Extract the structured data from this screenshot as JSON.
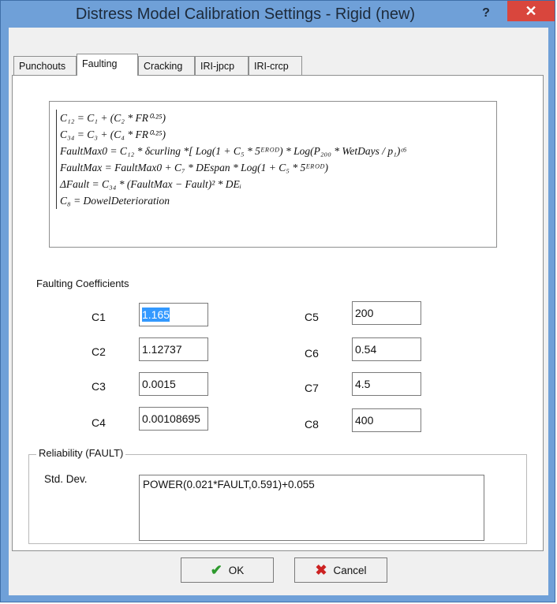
{
  "window": {
    "title": "Distress Model Calibration Settings - Rigid (new)",
    "help_glyph": "?",
    "close_glyph": "✕"
  },
  "tabs": [
    {
      "label": "Punchouts"
    },
    {
      "label": "Faulting"
    },
    {
      "label": "Cracking"
    },
    {
      "label": "IRI-jpcp"
    },
    {
      "label": "IRI-crcp"
    }
  ],
  "active_tab": "Faulting",
  "formula": {
    "lines": [
      "C₁₂ = C₁ + (C₂ * FR⁰·²⁵)",
      "C₃₄ = C₃ + (C₄ * FR⁰·²⁵)",
      "FaultMax0 = C₁₂ * δcurling *[ Log(1 + C₅ * 5ᴱᴿᴼᴰ) * Log(P₂₀₀ * WetDays / p₁)ᶜ⁶",
      "FaultMax = FaultMax0 + C₇ * DEspan * Log(1 + C₅ * 5ᴱᴿᴼᴰ)",
      "ΔFault = C₃₄ * (FaultMax − Fault)² * DEᵢ",
      "C₈ = DowelDeterioration"
    ]
  },
  "coefficients": {
    "section_label": "Faulting Coefficients",
    "left": [
      {
        "label": "C1",
        "value": "1.165",
        "selected": true
      },
      {
        "label": "C2",
        "value": "1.12737"
      },
      {
        "label": "C3",
        "value": "0.0015"
      },
      {
        "label": "C4",
        "value": "0.00108695"
      }
    ],
    "right": [
      {
        "label": "C5",
        "value": "200"
      },
      {
        "label": "C6",
        "value": "0.54"
      },
      {
        "label": "C7",
        "value": "4.5"
      },
      {
        "label": "C8",
        "value": "400"
      }
    ]
  },
  "reliability": {
    "group_title": "Reliability (FAULT)",
    "std_dev_label": "Std. Dev.",
    "std_dev_value": "POWER(0.021*FAULT,0.591)+0.055"
  },
  "buttons": {
    "ok_label": "OK",
    "cancel_label": "Cancel",
    "ok_icon": "checkmark-icon",
    "cancel_icon": "x-icon"
  },
  "colors": {
    "titlebar": "#6fa0d8",
    "close_button": "#d9463d",
    "selection": "#3399ff",
    "ok_check": "#2e9a2e",
    "cancel_x": "#cc2222"
  }
}
